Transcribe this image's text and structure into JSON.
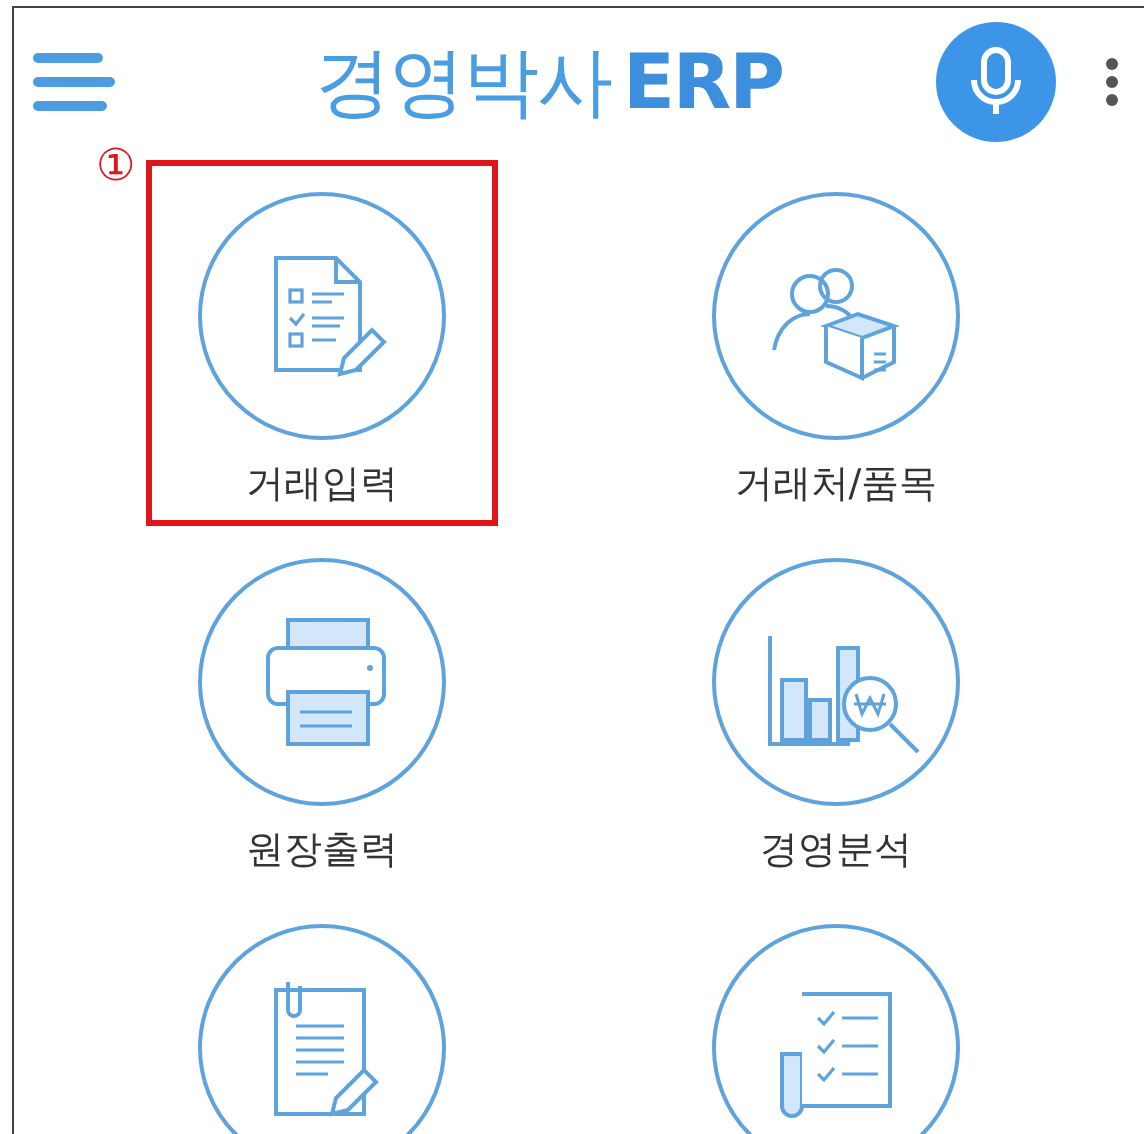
{
  "header": {
    "title": "경영박사",
    "title_suffix": "ERP"
  },
  "tiles": [
    {
      "kind": "entry",
      "label": "거래입력",
      "highlighted": true,
      "marker": "①"
    },
    {
      "kind": "partners",
      "label": "거래처/품목",
      "highlighted": false
    },
    {
      "kind": "print",
      "label": "원장출력",
      "highlighted": false
    },
    {
      "kind": "analysis",
      "label": "경영분석",
      "highlighted": false
    },
    {
      "kind": "memo",
      "highlighted": false
    },
    {
      "kind": "checklist",
      "highlighted": false
    }
  ]
}
